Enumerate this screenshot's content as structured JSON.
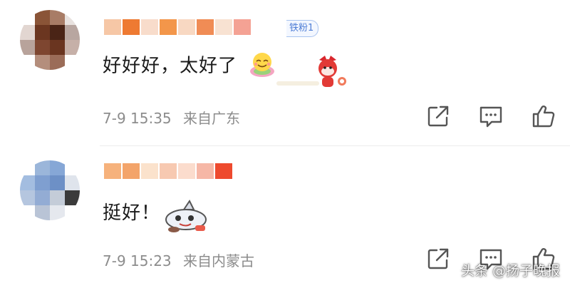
{
  "comments": [
    {
      "text": "好好好，太好了",
      "fan_badge": "铁粉1",
      "time": "7-9 15:35",
      "location": "来自广东",
      "name_colors": [
        "#f6c7a6",
        "#ee7a32",
        "#f8dccb",
        "#f3964a",
        "#f8d8c2",
        "#f08c55",
        "#f8e2d2",
        "#f4a294"
      ],
      "avatar_colors": [
        "#ffffff",
        "#8a5437",
        "#a87c66",
        "#e8e2df",
        "#e2d6d1",
        "#6b3620",
        "#4a2416",
        "#b8a6a0",
        "#b8a39b",
        "#7e4630",
        "#6a3520",
        "#c6b0a8",
        "#ffffff",
        "#b48e7c",
        "#9b6c58",
        "#ffffff"
      ]
    },
    {
      "text": "挺好！",
      "time": "7-9 15:23",
      "location": "来自内蒙古",
      "name_colors": [
        "#f6b27c",
        "#f3a46a",
        "#fbe2cc",
        "#f7c9b1",
        "#fbdccd",
        "#f6b7a6",
        "#ee4a2e"
      ],
      "avatar_colors": [
        "#ffffff",
        "#9bb6da",
        "#86a7d6",
        "#ffffff",
        "#a3bde0",
        "#7f9fd0",
        "#6d90c6",
        "#dfe4ec",
        "#b5c6df",
        "#93acd4",
        "#c4ccd8",
        "#3b3b3b",
        "#ffffff",
        "#b9c4d6",
        "#e5e8ee",
        "#ffffff"
      ]
    }
  ],
  "action_icons": [
    "share-icon",
    "comment-icon",
    "like-icon"
  ],
  "watermark": "头条 @扬子晚报"
}
